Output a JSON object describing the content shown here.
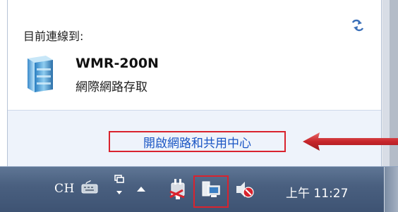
{
  "flyout": {
    "title": "目前連線到:",
    "network": {
      "name": "WMR-200N",
      "status": "網際網路存取"
    },
    "open_center_link": "開啟網路和共用中心",
    "icons": {
      "refresh": "refresh-arrows-icon",
      "network": "server-network-icon"
    }
  },
  "annotation": {
    "highlight_color": "#d9232e",
    "arrow": "red-left-arrow"
  },
  "taskbar": {
    "input_language": "CH",
    "clock": "上午 11:27",
    "tray_icons": [
      "keyboard-icon",
      "language-bar-icon",
      "show-hidden-icons-icon",
      "power-plug-icon",
      "network-icon",
      "volume-muted-icon"
    ]
  },
  "colors": {
    "link": "#1a56c4",
    "taskbar": "#4a6080",
    "footer": "#eef3fb"
  }
}
